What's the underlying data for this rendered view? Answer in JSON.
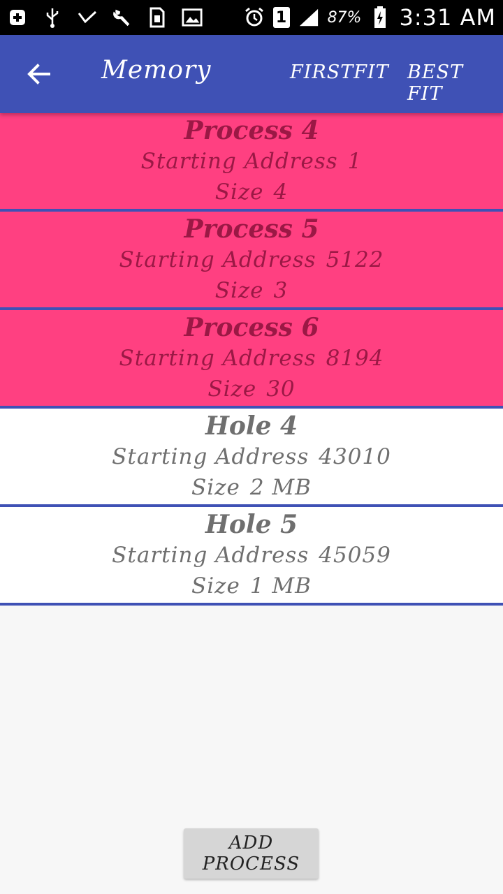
{
  "status_bar": {
    "icons": [
      "add-notification-icon",
      "usb-icon",
      "check-icon",
      "wrench-icon",
      "sim-icon",
      "image-icon",
      "alarm-icon",
      "signal-icon",
      "battery-charging-icon"
    ],
    "sim_slot": "1",
    "battery": "87%",
    "time": "3:31 AM"
  },
  "app_bar": {
    "title": "Memory",
    "action_first_fit": "FIRSTFIT",
    "action_best_fit": "BEST FIT",
    "back_icon": "arrow-back-icon"
  },
  "blocks": [
    {
      "type": "process",
      "title": "Process 4",
      "address_label": "Starting Address",
      "address": "1",
      "size_label": "Size",
      "size": "4"
    },
    {
      "type": "process",
      "title": "Process 5",
      "address_label": "Starting Address",
      "address": "5122",
      "size_label": "Size",
      "size": "3"
    },
    {
      "type": "process",
      "title": "Process 6",
      "address_label": "Starting Address",
      "address": "8194",
      "size_label": "Size",
      "size": "30"
    },
    {
      "type": "hole",
      "title": "Hole 4",
      "address_label": "Starting Address",
      "address": "43010",
      "size_label": "Size",
      "size": "2 MB"
    },
    {
      "type": "hole",
      "title": "Hole 5",
      "address_label": "Starting Address",
      "address": "45059",
      "size_label": "Size",
      "size": "1 MB"
    }
  ],
  "add_button": {
    "label": "ADD PROCESS"
  },
  "colors": {
    "app_bar": "#3f51b5",
    "process_bg": "#ff4081",
    "process_text": "#9b1845",
    "hole_bg": "#ffffff",
    "hole_text": "#6f6f6f",
    "divider": "#3f51b5",
    "button_bg": "#d6d6d6"
  }
}
